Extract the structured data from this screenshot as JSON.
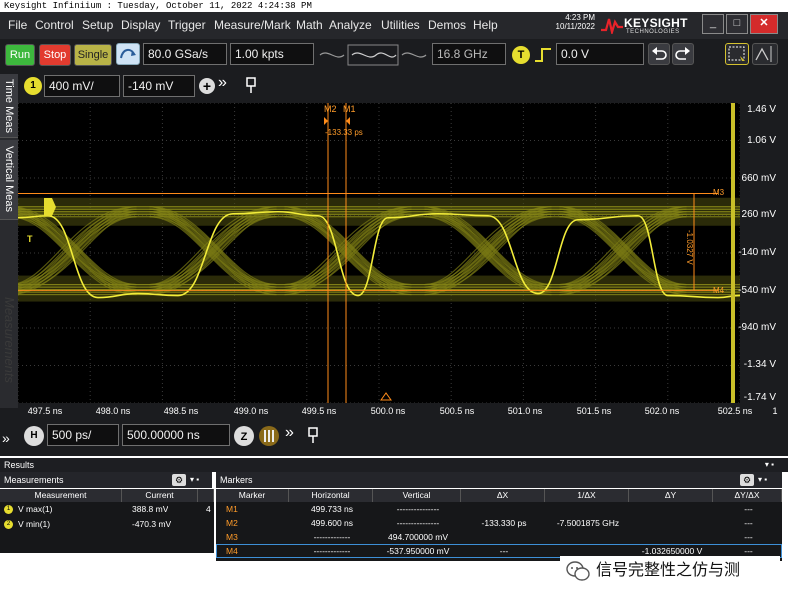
{
  "title_bar": "Keysight Infiniium : Tuesday, October 11, 2022 4:24:38 PM",
  "menu": [
    "File",
    "Control",
    "Setup",
    "Display",
    "Trigger",
    "Measure/Mark",
    "Math",
    "Analyze",
    "Utilities",
    "Demos",
    "Help"
  ],
  "clock": {
    "time": "4:23 PM",
    "date": "10/11/2022"
  },
  "logo": {
    "brand": "KEYSIGHT",
    "sub": "TECHNOLOGIES"
  },
  "window_buttons": [
    "_",
    "□",
    "✕"
  ],
  "toolbar": {
    "run": "Run",
    "stop": "Stop",
    "single": "Single",
    "sample_rate": "80.0 GSa/s",
    "memory_depth": "1.00 kpts",
    "bandwidth": "16.8 GHz",
    "trigger_label": "T",
    "trigger_level": "0.0 V",
    "undo_icon": "undo-icon",
    "redo_icon": "redo-icon"
  },
  "channel": {
    "badge": "1",
    "scale": "400 mV/",
    "offset": "-140 mV",
    "add": "+",
    "more": "»"
  },
  "side_tabs": [
    "Time Meas",
    "Vertical Meas"
  ],
  "side_watermark": "Measurements",
  "markers_top": {
    "m2": "M2",
    "m1": "M1",
    "delta": "-133.33 ps"
  },
  "marker_right": {
    "m3": "M3",
    "m4": "M4",
    "delta_v": "-1.0327 V"
  },
  "y_axis": [
    "1.46 V",
    "1.06 V",
    "660 mV",
    "260 mV",
    "-140 mV",
    "-540 mV",
    "-940 mV",
    "-1.34 V",
    "-1.74 V"
  ],
  "x_axis": [
    "497.5 ns",
    "498.0 ns",
    "498.5 ns",
    "499.0 ns",
    "499.5 ns",
    "500.0 ns",
    "500.5 ns",
    "501.0 ns",
    "501.5 ns",
    "502.0 ns",
    "502.5 ns"
  ],
  "x_axis_extra": "1",
  "timebase": {
    "badge": "H",
    "scale": "500 ps/",
    "position": "500.00000 ns"
  },
  "results": {
    "title": "Results",
    "measurements": {
      "title": "Measurements",
      "headers": [
        "Measurement",
        "Current"
      ],
      "rows": [
        {
          "badge": "1",
          "name": "V max(1)",
          "current": "388.8 mV",
          "extra": "4"
        },
        {
          "badge": "2",
          "name": "V min(1)",
          "current": "-470.3 mV",
          "extra": ""
        }
      ]
    },
    "markers": {
      "title": "Markers",
      "headers": [
        "Marker",
        "Horizontal",
        "Vertical",
        "ΔX",
        "1/ΔX",
        "ΔY",
        "ΔY/ΔX"
      ],
      "rows": [
        [
          "M1",
          "499.733 ns",
          "---------------",
          "",
          "",
          "",
          "---"
        ],
        [
          "M2",
          "499.600 ns",
          "---------------",
          "-133.330 ps",
          "-7.5001875 GHz",
          "",
          "---"
        ],
        [
          "M3",
          "-------------",
          "494.700000 mV",
          "",
          "",
          "",
          "---"
        ],
        [
          "M4",
          "-------------",
          "-537.950000 mV",
          "---",
          "",
          "-1.032650000 V",
          "---"
        ]
      ]
    }
  },
  "watermark": "信号完整性之仿与测",
  "colors": {
    "trace": "#e0e020",
    "persist": "#6b6b12",
    "marker": "#ff8c1a",
    "run": "#3db83d",
    "stop": "#e23b2f",
    "single": "#b8b347"
  }
}
